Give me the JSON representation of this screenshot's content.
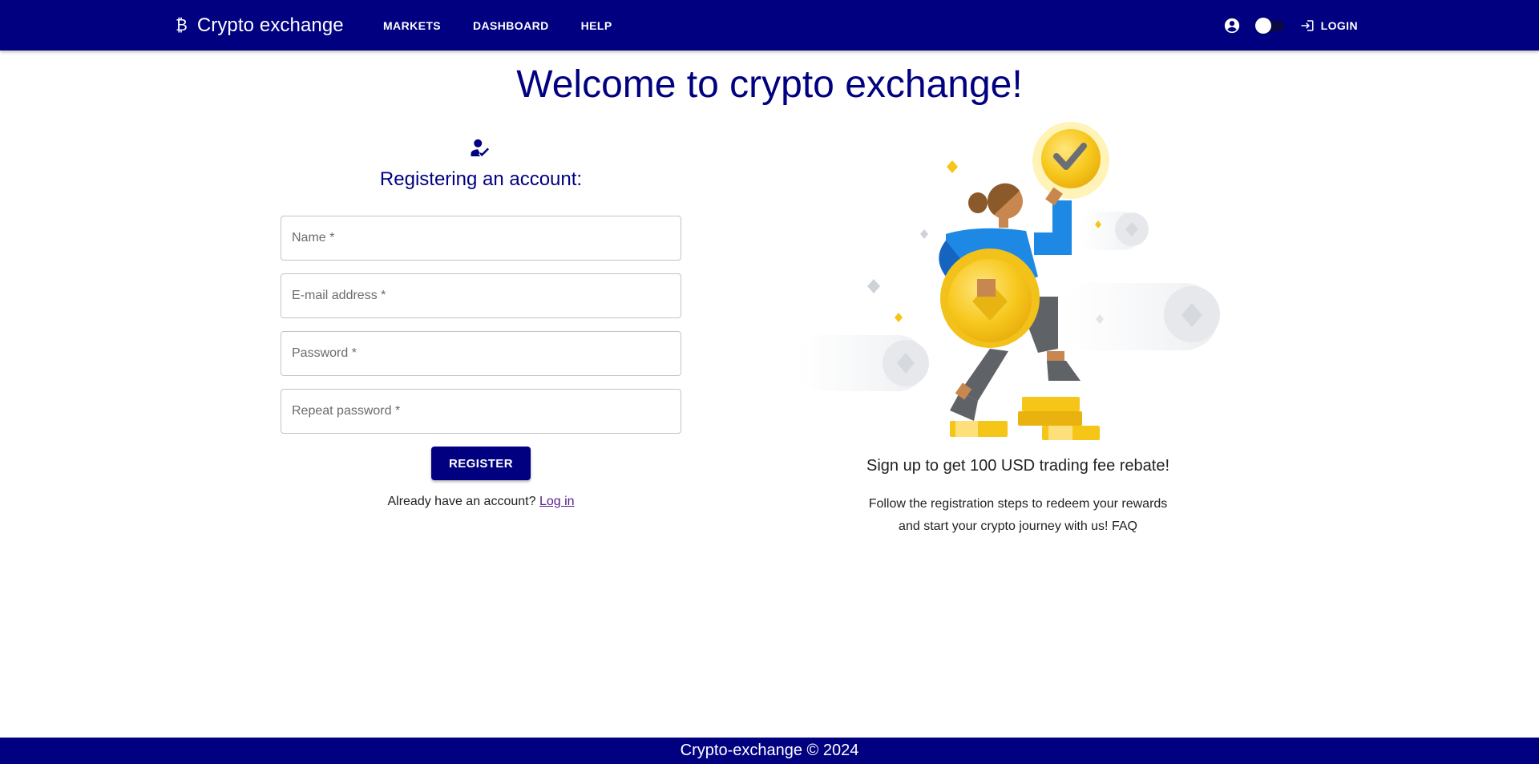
{
  "header": {
    "brand_icon": "bitcoin-icon",
    "brand_symbol": "₿",
    "brand_title": "Crypto exchange",
    "nav": [
      "MARKETS",
      "DASHBOARD",
      "HELP"
    ],
    "login_label": "LOGIN",
    "theme_toggle": "off"
  },
  "page": {
    "title": "Welcome to crypto exchange!"
  },
  "register": {
    "title": "Registering an account:",
    "fields": {
      "name": "Name *",
      "email": "E-mail address *",
      "password": "Password *",
      "repeat_password": "Repeat password *"
    },
    "submit_label": "REGISTER",
    "have_account_text": "Already have an account?",
    "login_link": "Log in"
  },
  "promo": {
    "title": "Sign up to get 100 USD trading fee rebate!",
    "text_line1": "Follow the registration steps to redeem your rewards",
    "text_line2": "and start your crypto journey with us! FAQ"
  },
  "footer": {
    "text": "Crypto-exchange © 2024"
  },
  "colors": {
    "primary": "#000080",
    "coin": "#f5c518",
    "shirt": "#1e88e5"
  }
}
